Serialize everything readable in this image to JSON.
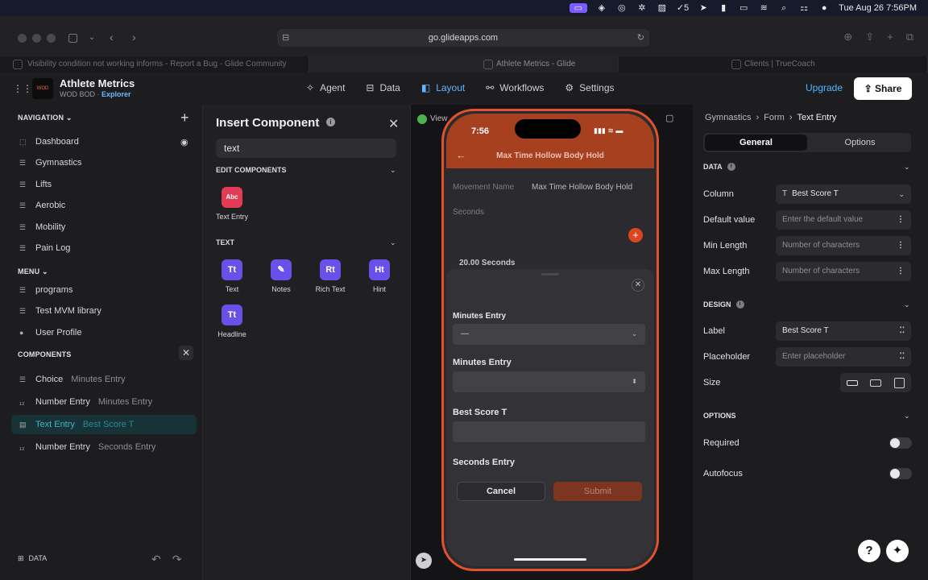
{
  "menubar": {
    "battery_count": "5",
    "datetime": "Tue Aug 26  7:56PM"
  },
  "browser": {
    "url": "go.glideapps.com",
    "tabs": [
      {
        "label": "Visibility condition not working informs - Report a Bug - Glide Community"
      },
      {
        "label": "Athlete Metrics - Glide"
      },
      {
        "label": "Clients | TrueCoach"
      }
    ]
  },
  "app": {
    "title": "Athlete Metrics",
    "org": "WOD BOD",
    "plan": "Explorer",
    "logo_text": "WOD BOD"
  },
  "topnav": [
    {
      "label": "Agent",
      "icon": "sparkle-icon"
    },
    {
      "label": "Data",
      "icon": "table-icon"
    },
    {
      "label": "Layout",
      "icon": "layout-icon"
    },
    {
      "label": "Workflows",
      "icon": "workflow-icon"
    },
    {
      "label": "Settings",
      "icon": "gear-icon"
    }
  ],
  "upgrade_label": "Upgrade",
  "share_label": "Share",
  "navigation": {
    "header": "NAVIGATION",
    "items": [
      {
        "label": "Dashboard"
      },
      {
        "label": "Gymnastics"
      },
      {
        "label": "Lifts"
      },
      {
        "label": "Aerobic"
      },
      {
        "label": "Mobility"
      },
      {
        "label": "Pain Log"
      }
    ],
    "menu_header": "MENU",
    "menu_items": [
      {
        "label": "programs"
      },
      {
        "label": "Test MVM library"
      },
      {
        "label": "User Profile"
      }
    ],
    "components_header": "COMPONENTS",
    "components": [
      {
        "type": "Choice",
        "name": "Minutes Entry"
      },
      {
        "type": "Number Entry",
        "name": "Minutes Entry"
      },
      {
        "type": "Text Entry",
        "name": "Best Score T"
      },
      {
        "type": "Number Entry",
        "name": "Seconds Entry"
      }
    ],
    "data_label": "DATA"
  },
  "insert": {
    "title": "Insert Component",
    "search_value": "text",
    "edit_header": "EDIT COMPONENTS",
    "edit_items": [
      {
        "label": "Text Entry",
        "glyph": "Abc"
      }
    ],
    "text_header": "TEXT",
    "text_items": [
      {
        "label": "Text",
        "glyph": "Tt"
      },
      {
        "label": "Notes",
        "glyph": "✎"
      },
      {
        "label": "Rich Text",
        "glyph": "Rt"
      },
      {
        "label": "Hint",
        "glyph": "Ht"
      },
      {
        "label": "Headline",
        "glyph": "Tt"
      }
    ]
  },
  "preview": {
    "view_label": "View",
    "time": "7:56",
    "screen_title": "Max Time Hollow Body Hold",
    "movement_label": "Movement Name",
    "movement_value": "Max Time Hollow Body Hold",
    "seconds_label": "Seconds",
    "seconds_value": "20.00 Seconds",
    "form": {
      "field1_label": "Minutes Entry",
      "field1_value": "—",
      "field2_label": "Minutes Entry",
      "field3_label": "Best Score T",
      "field4_label": "Seconds Entry",
      "cancel_label": "Cancel",
      "submit_label": "Submit"
    }
  },
  "props": {
    "breadcrumb": [
      "Gymnastics",
      "Form",
      "Text Entry"
    ],
    "tabs": [
      "General",
      "Options"
    ],
    "data_section": "DATA",
    "column_label": "Column",
    "column_value": "Best Score T",
    "default_label": "Default value",
    "default_placeholder": "Enter the default value",
    "min_label": "Min Length",
    "min_placeholder": "Number of characters",
    "max_label": "Max Length",
    "max_placeholder": "Number of characters",
    "design_section": "DESIGN",
    "label_label": "Label",
    "label_value": "Best Score T",
    "placeholder_label": "Placeholder",
    "placeholder_placeholder": "Enter placeholder",
    "size_label": "Size",
    "options_section": "OPTIONS",
    "required_label": "Required",
    "required_on": false,
    "autofocus_label": "Autofocus",
    "autofocus_on": false
  },
  "colors": {
    "accent": "#5eb6ff",
    "phone_bar": "#a6401f",
    "selected": "#3fb6c7"
  }
}
